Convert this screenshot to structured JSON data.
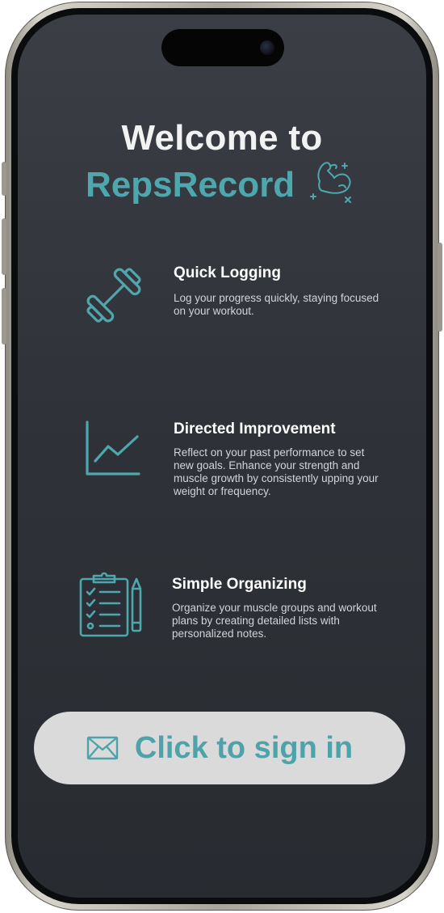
{
  "welcome": {
    "line1": "Welcome to",
    "brand": "RepsRecord"
  },
  "features": [
    {
      "icon": "dumbbell-icon",
      "title": "Quick Logging",
      "description": "Log your progress quickly, staying focused on your workout."
    },
    {
      "icon": "line-chart-icon",
      "title": "Directed Improvement",
      "description": "Reflect on your past performance to set new goals. Enhance your strength and muscle growth by consistently upping your weight or frequency."
    },
    {
      "icon": "clipboard-list-icon",
      "title": "Simple Organizing",
      "description": "Organize your muscle groups and workout plans by creating detailed lists with personalized notes."
    }
  ],
  "signin": {
    "icon": "envelope-icon",
    "label": "Click to sign in"
  },
  "colors": {
    "accent": "#4fa7ae",
    "background_top": "#3b3f45",
    "background_bottom": "#282c31",
    "title_text": "#f2f2f2",
    "body_text": "#d1d4d8",
    "button_bg": "#dadadb"
  }
}
